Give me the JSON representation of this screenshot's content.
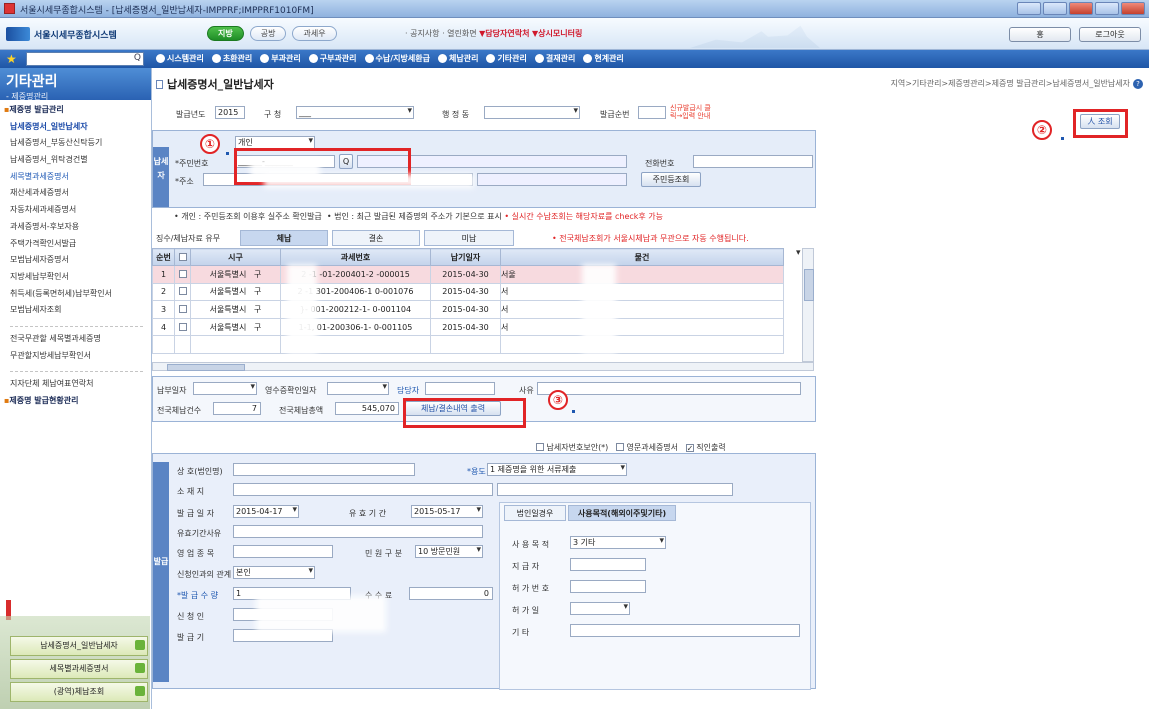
{
  "window": {
    "title": "서울시세무종합시스템 - [납세증명서_일반납세자-IMPPRF;IMPPRF1010FM]"
  },
  "header": {
    "logo_text": "서울시세무종합시스템",
    "pills": [
      "지방",
      "공방",
      "과세우"
    ],
    "links_plain": "· 공지사항 · 열린화면",
    "link_red1": "▼담당자연락처",
    "link_red2": "▼상시모니터링",
    "btn_user": "홍",
    "btn_logout": "로그아웃"
  },
  "menu": {
    "items": [
      "시스템관리",
      "초환관리",
      "부과관리",
      "구부과관리",
      "수납/지방세환급",
      "체납관리",
      "기타관리",
      "결재관리",
      "현계관리"
    ]
  },
  "sidebar": {
    "title": "기타관리",
    "subtitle": "- 제증명관리",
    "items": [
      {
        "label": "제증명 발급관리",
        "kind": "group"
      },
      {
        "label": "납세증명서_일반납세자",
        "kind": "active"
      },
      {
        "label": "납세증명서_부동산신탁등기",
        "kind": "normal"
      },
      {
        "label": "납세증명서_위탁경건별",
        "kind": "normal"
      },
      {
        "label": "세목별과세증명서",
        "kind": "blue"
      },
      {
        "label": "재산세과세증명서",
        "kind": "normal"
      },
      {
        "label": "자동차세과세증명서",
        "kind": "normal"
      },
      {
        "label": "과세증명서-후보자용",
        "kind": "normal"
      },
      {
        "label": "주택가격확인서발급",
        "kind": "normal"
      },
      {
        "label": "모범납세자증명서",
        "kind": "normal"
      },
      {
        "label": "지방세납부확인서",
        "kind": "normal"
      },
      {
        "label": "취득세(등록면허세)납부확인서",
        "kind": "normal"
      },
      {
        "label": "모범납세자조회",
        "kind": "normal"
      }
    ],
    "items2": [
      "전국무관할 세목별과세증명",
      "무관할지방세납부확인서"
    ],
    "items3": [
      {
        "label": "지자단체 체납여표연락처",
        "kind": "normal"
      },
      {
        "label": "제증명 발급현황관리",
        "kind": "group"
      }
    ],
    "quick": [
      "납세증명서_일반납세자",
      "세목별과세증명서",
      "(광역)체납조회"
    ]
  },
  "main": {
    "title": "납세증명서_일반납세자",
    "breadcrumb": "지역>기타관리>제증명관리>제증명 발급관리>납세증명서_일반납세자",
    "help": "?",
    "top": {
      "lbl_year": "발급년도",
      "year_val": "2015",
      "lbl_gu": "구 청",
      "gu_val": "___",
      "lbl_dong": "행 정 동",
      "lbl_no": "발급순번",
      "badge": "신규발급시 클릭→입력 안내",
      "print_btn": "人 조회"
    },
    "applicant": {
      "side": "납세자",
      "type_sel": "개인",
      "lbl_id": "*주민번호",
      "id_val": "______-_______",
      "search_icon": "Q",
      "lbl_addr": "*주소",
      "lbl_phone": "전화번호",
      "addr_btn": "주민등조회",
      "notice1": "• 개인 : 주민등조회 이용후 실주소 확인발급",
      "notice2": "• 법인 : 최근 발급된 제증명의 주소가 기본으로 표시",
      "notice3": "• 실시간 수납조회는 해당자료를 check후 가능"
    },
    "tabs": {
      "lead": "징수/체납자료 유무",
      "t1": "체납",
      "t2": "결손",
      "t3": "미납",
      "warn": "• 전국체납조회가 서울시체납과 무관으로 자동 수행됩니다."
    },
    "grid": {
      "headers": [
        "순번",
        "",
        "시구",
        "과세번호",
        "납기일자",
        "물건"
      ],
      "rows": [
        [
          "1",
          "서울특별시",
          "구",
          "2 -1 -01-200401-2 -000015",
          "2015-04-30",
          "서울"
        ],
        [
          "2",
          "서울특별시",
          "구",
          "2 -1 301-200406-1 0-001076",
          "2015-04-30",
          "서"
        ],
        [
          "3",
          "서울특별시",
          "구",
          "}- 001-200212-1- 0-001104",
          "2015-04-30",
          "서"
        ],
        [
          "4",
          "서울특별시",
          "구",
          "1-1, 01-200306-1- 0-001105",
          "2015-04-30",
          "서"
        ]
      ]
    },
    "payment": {
      "lbl_paydate": "납부일자",
      "lbl_receipt": "영수증확인일자",
      "lbl_officer": "담당자",
      "lbl_reason": "사유",
      "lbl_count": "전국체납건수",
      "count_val": "7",
      "lbl_amount": "전국체납총액",
      "amount_val": "545,070",
      "print_arrears_btn": "체납/결손내역 출력"
    },
    "options": {
      "opt1": "납세자번호보안(*)",
      "opt2": "영문과세증명서",
      "opt3": "직인출력"
    },
    "issue": {
      "side": "발급정보",
      "lbl_name": "상 호(법인명)",
      "lbl_purpose": "*용도",
      "purpose_val": "1 제증명을 위한 서류제출",
      "lbl_addr": "소 재 지",
      "lbl_issue_date": "발 급 일 자",
      "issue_date_val": "2015-04-17",
      "lbl_valid": "유 효 기 간",
      "valid_val": "2015-05-17",
      "lbl_valid_reason": "유효기간사유",
      "lbl_biz": "영 업 종 목",
      "lbl_civil": "민 원 구 분",
      "civil_val": "10 방문민원",
      "lbl_relation": "신청인과의 관계",
      "relation_val": "본인",
      "lbl_copies": "*발 급 수 량",
      "copies_val": "1",
      "lbl_fee": "수 수 료",
      "fee_val": "0",
      "lbl_applicant": "신 청 인",
      "lbl_issuer": "발 급 기",
      "corp_tab1": "법인일경우",
      "corp_tab2": "사용목적(해외이주및기타)",
      "lbl_use": "사 용 목 적",
      "use_val": "3 기타",
      "lbl_sub_addr": "지 급 자",
      "lbl_permit": "허 가 번 호",
      "lbl_permit_date": "허 가 일",
      "lbl_etc": "기 타"
    },
    "markers": [
      "①",
      "②",
      "③"
    ]
  },
  "colors": {
    "accent": "#1f56a6",
    "highlight": "#e12426",
    "selected_row": "#f7dadf"
  }
}
